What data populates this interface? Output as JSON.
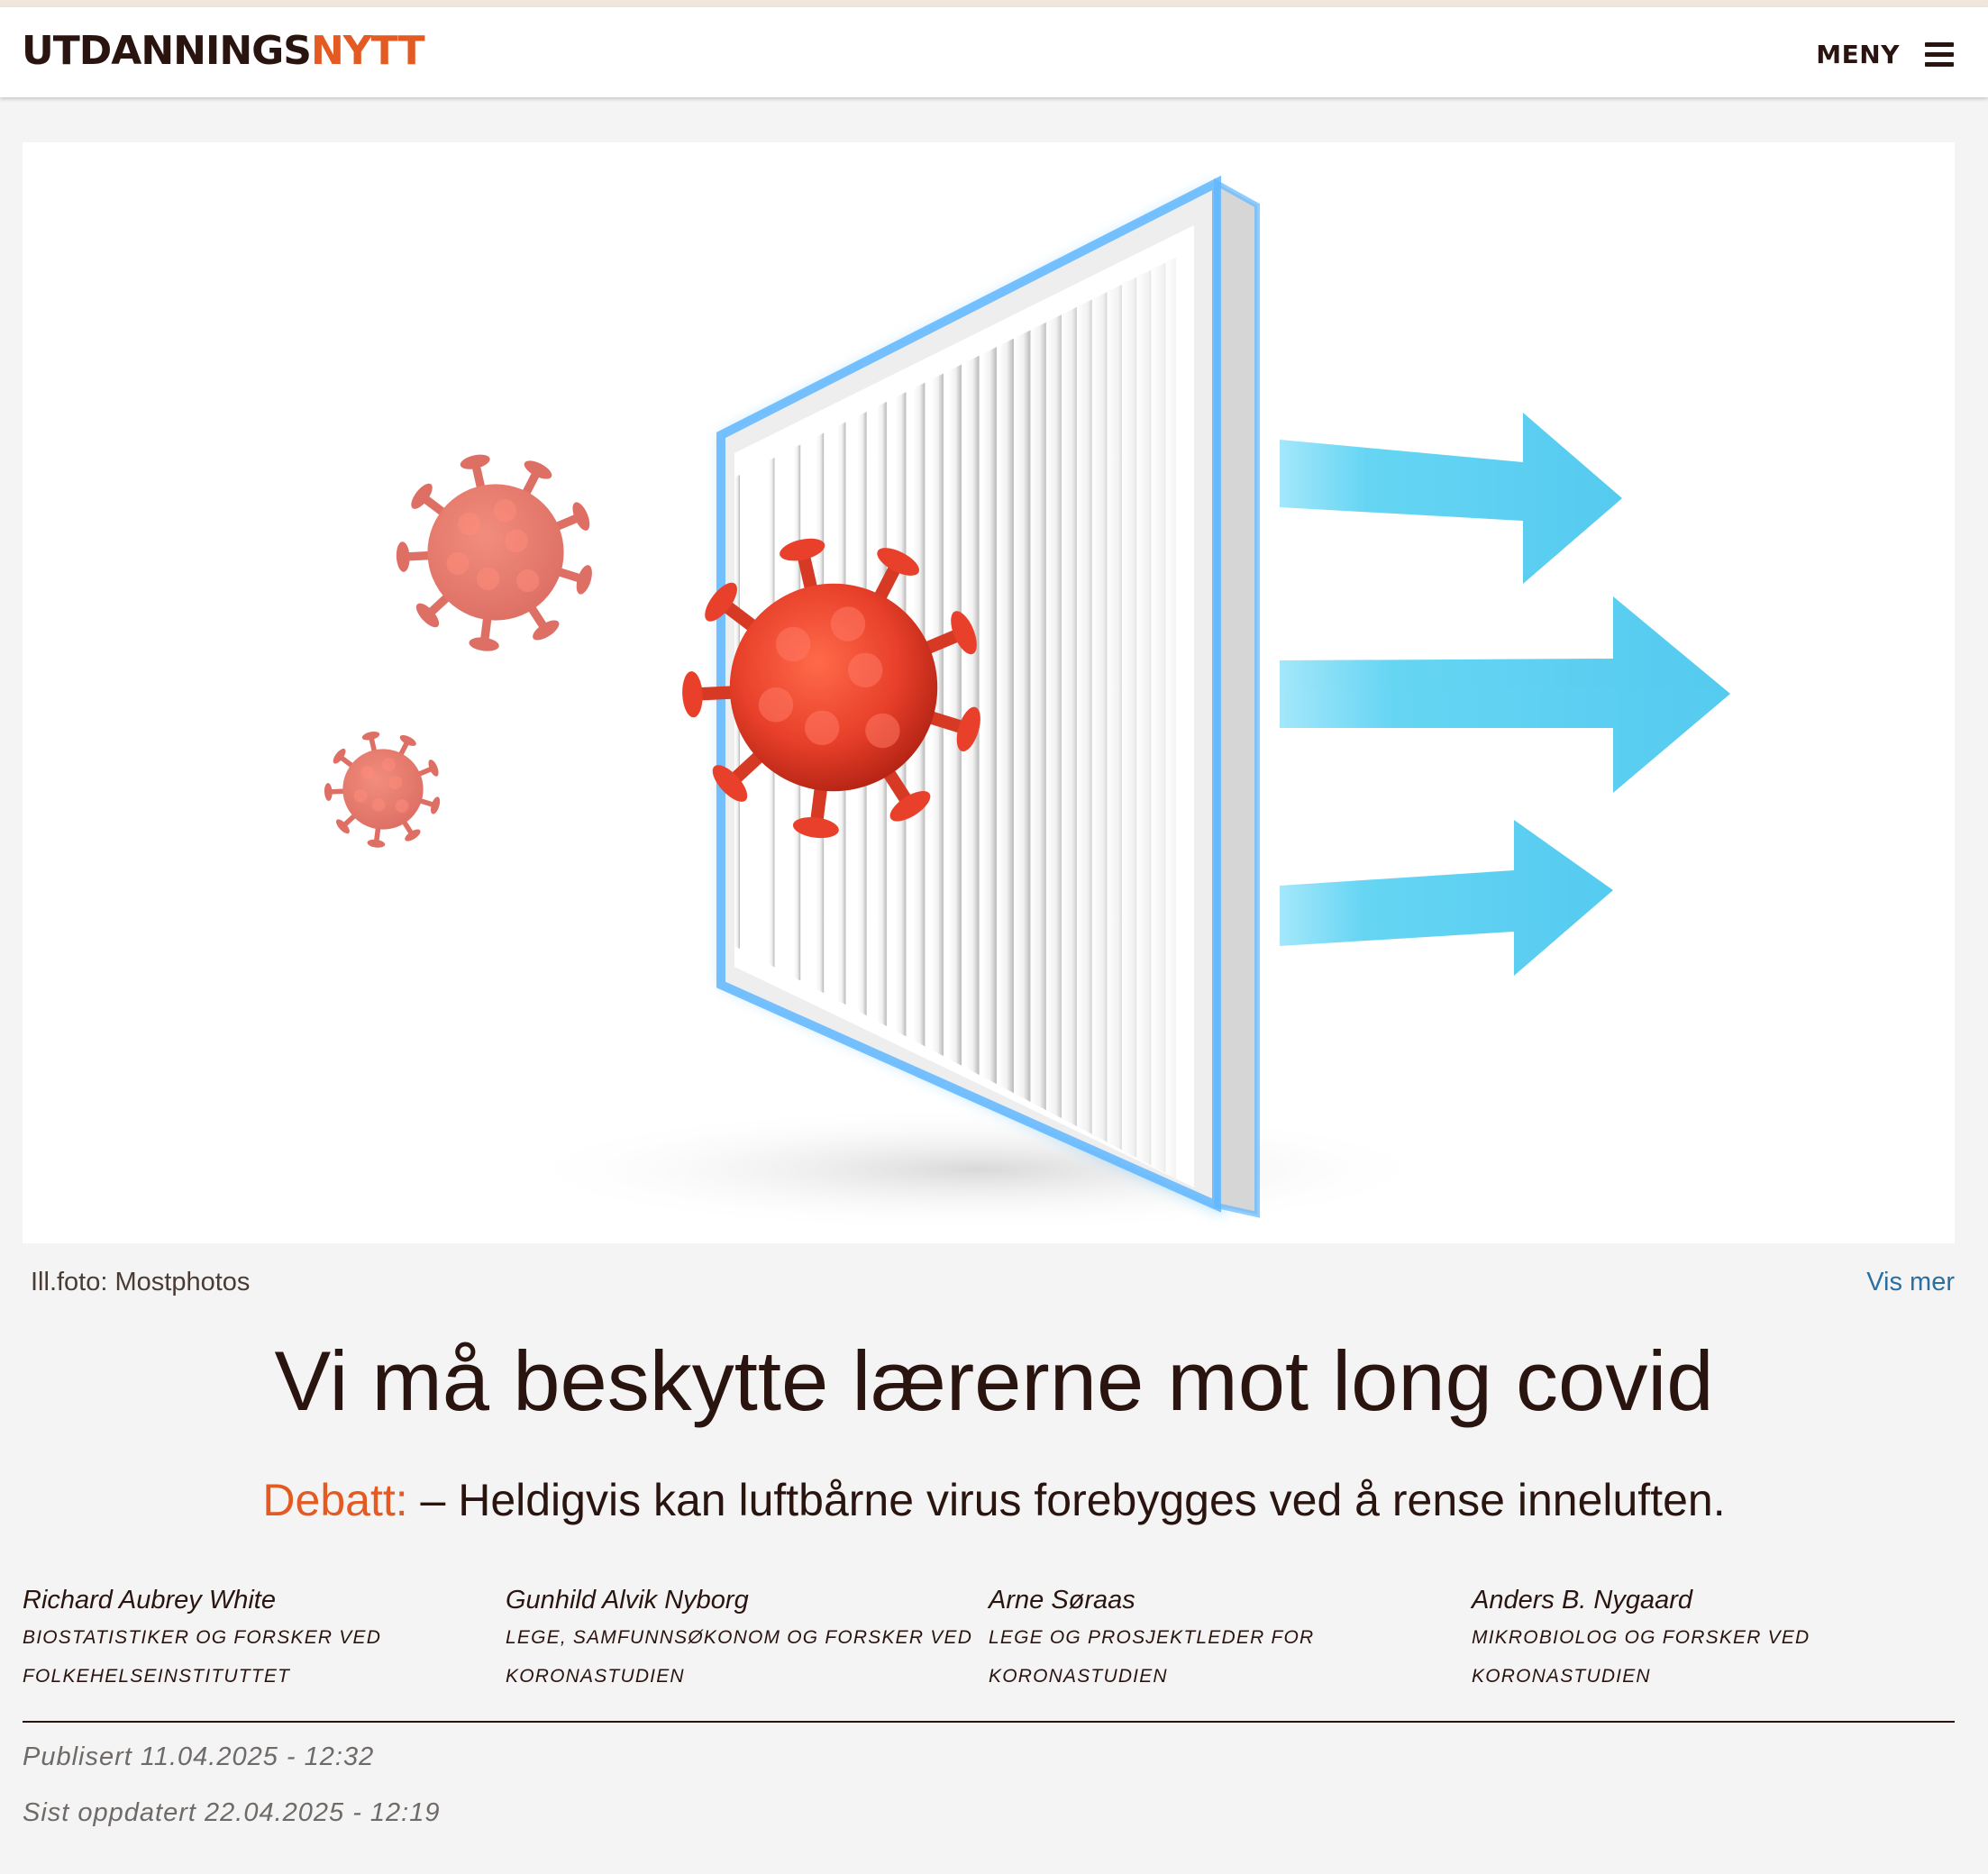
{
  "header": {
    "logo_part1": "UTDANNINGS",
    "logo_part2": "NYTT",
    "menu_label": "MENY",
    "menu_icon": "hamburger-icon"
  },
  "hero": {
    "image_description_icon": "virus-air-filter-illustration",
    "credit": "Ill.foto: Mostphotos",
    "more_link": "Vis mer"
  },
  "article": {
    "title": "Vi må beskytte lærerne mot long covid",
    "kicker": "Debatt:",
    "lead": " – Heldigvis kan luftbårne virus forebygges ved å rense inneluften.",
    "authors": [
      {
        "name": "Richard Aubrey White",
        "role_line1": "Biostatistiker og forsker ved",
        "role_line2": "Folkehelseinstituttet"
      },
      {
        "name": "Gunhild Alvik Nyborg",
        "role_line1": "Lege, samfunnsøkonom og forsker ved",
        "role_line2": "Koronastudien"
      },
      {
        "name": "Arne Søraas",
        "role_line1": "Lege og prosjektleder for",
        "role_line2": "Koronastudien"
      },
      {
        "name": "Anders B. Nygaard",
        "role_line1": "Mikrobiolog og forsker ved",
        "role_line2": "Koronastudien"
      }
    ],
    "published": "Publisert 11.04.2025 - 12:32",
    "updated": "Sist oppdatert 22.04.2025 - 12:19"
  },
  "colors": {
    "brand_dark": "#2a1410",
    "brand_orange": "#e35b22",
    "link_blue": "#2a6fa0",
    "filter_glow": "#4fb8ff",
    "arrow_cyan": "#5ed3f3",
    "virus_red": "#e8402a"
  }
}
